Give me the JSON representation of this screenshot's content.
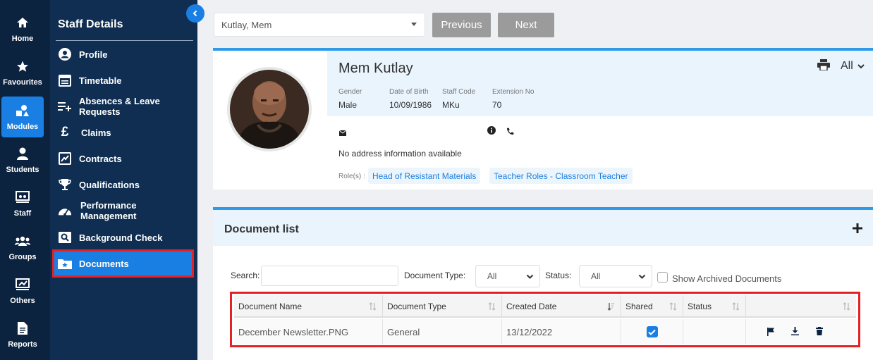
{
  "rail": {
    "items": [
      {
        "label": "Home",
        "icon": "home-icon"
      },
      {
        "label": "Favourites",
        "icon": "star-icon"
      },
      {
        "label": "Modules",
        "icon": "modules-icon"
      },
      {
        "label": "Students",
        "icon": "user-icon"
      },
      {
        "label": "Staff",
        "icon": "staff-icon"
      },
      {
        "label": "Groups",
        "icon": "group-icon"
      },
      {
        "label": "Others",
        "icon": "others-icon"
      },
      {
        "label": "Reports",
        "icon": "report-icon"
      }
    ],
    "active": "Modules",
    "active_color": "#1a7fe3"
  },
  "sidebar": {
    "title": "Staff Details",
    "items": [
      {
        "label": "Profile",
        "icon": "user-circle-icon"
      },
      {
        "label": "Timetable",
        "icon": "calendar-icon"
      },
      {
        "label": "Absences & Leave Requests",
        "icon": "list-plus-icon"
      },
      {
        "label": "Claims",
        "icon": "pound-icon"
      },
      {
        "label": "Contracts",
        "icon": "contract-icon"
      },
      {
        "label": "Qualifications",
        "icon": "trophy-icon"
      },
      {
        "label": "Performance Management",
        "icon": "gauge-icon"
      },
      {
        "label": "Background Check",
        "icon": "search-card-icon"
      },
      {
        "label": "Documents",
        "icon": "folder-star-icon"
      }
    ],
    "active": "Documents"
  },
  "toolbar": {
    "staff_select_value": "Kutlay, Mem",
    "previous_label": "Previous",
    "next_label": "Next"
  },
  "profile": {
    "name": "Mem Kutlay",
    "gender_label": "Gender",
    "gender": "Male",
    "dob_label": "Date of Birth",
    "dob": "10/09/1986",
    "staff_code_label": "Staff Code",
    "staff_code": "MKu",
    "extension_label": "Extension No",
    "extension": "70",
    "address": "No address information available",
    "roles_label": "Role(s) :",
    "roles": [
      "Head of Resistant Materials",
      "Teacher Roles - Classroom Teacher"
    ],
    "print_filter": "All"
  },
  "documents": {
    "title": "Document list",
    "search_label": "Search:",
    "search_value": "",
    "doc_type_label": "Document Type:",
    "doc_type_value": "All",
    "status_label": "Status:",
    "status_value": "All",
    "show_archived_label": "Show Archived Documents",
    "columns": [
      "Document Name",
      "Document Type",
      "Created Date",
      "Shared",
      "Status",
      ""
    ],
    "rows": [
      {
        "name": "December Newsletter.PNG",
        "type": "General",
        "created": "13/12/2022",
        "shared": true,
        "status": ""
      }
    ]
  }
}
